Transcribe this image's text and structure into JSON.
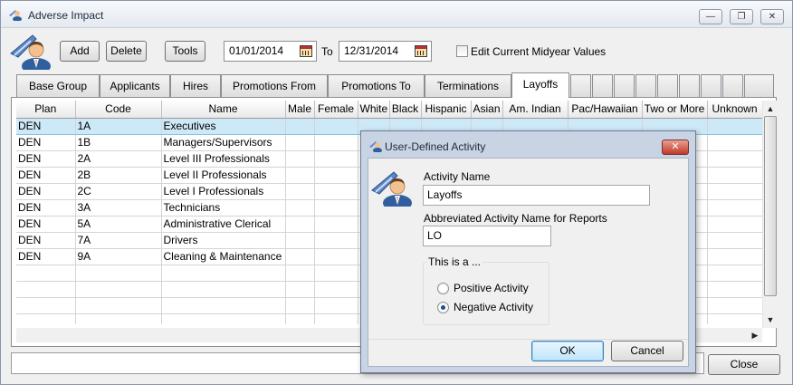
{
  "window": {
    "title": "Adverse Impact"
  },
  "toolbar": {
    "add_label": "Add",
    "delete_label": "Delete",
    "tools_label": "Tools",
    "start_date": "01/01/2014",
    "to_label": "To",
    "end_date": "12/31/2014",
    "midyear_label": "Edit Current Midyear Values"
  },
  "tabs": [
    {
      "label": "Base Group"
    },
    {
      "label": "Applicants"
    },
    {
      "label": "Hires"
    },
    {
      "label": "Promotions From"
    },
    {
      "label": "Promotions To"
    },
    {
      "label": "Terminations"
    },
    {
      "label": "Layoffs"
    }
  ],
  "grid": {
    "columns": [
      "Plan",
      "Code",
      "Name",
      "Male",
      "Female",
      "White",
      "Black",
      "Hispanic",
      "Asian",
      "Am. Indian",
      "Pac/Hawaiian",
      "Two or More",
      "Unknown"
    ],
    "rows": [
      [
        "DEN",
        "1A",
        "Executives"
      ],
      [
        "DEN",
        "1B",
        "Managers/Supervisors"
      ],
      [
        "DEN",
        "2A",
        "Level III Professionals"
      ],
      [
        "DEN",
        "2B",
        "Level II Professionals"
      ],
      [
        "DEN",
        "2C",
        "Level I Professionals"
      ],
      [
        "DEN",
        "3A",
        "Technicians"
      ],
      [
        "DEN",
        "5A",
        "Administrative Clerical"
      ],
      [
        "DEN",
        "7A",
        "Drivers"
      ],
      [
        "DEN",
        "9A",
        "Cleaning & Maintenance"
      ]
    ],
    "empty_rows": 4
  },
  "footer": {
    "close_label": "Close"
  },
  "dialog": {
    "title": "User-Defined Activity",
    "activity_name_label": "Activity Name",
    "activity_name_value": "Layoffs",
    "abbrev_label": "Abbreviated Activity Name for Reports",
    "abbrev_value": "LO",
    "group_label": "This is a ...",
    "positive_label": "Positive Activity",
    "negative_label": "Negative Activity",
    "selected": "negative",
    "ok_label": "OK",
    "cancel_label": "Cancel"
  },
  "colors": {
    "selection": "#cde8f7",
    "dialog_frame": "#c8d4e4",
    "close_button": "#c0392b"
  }
}
